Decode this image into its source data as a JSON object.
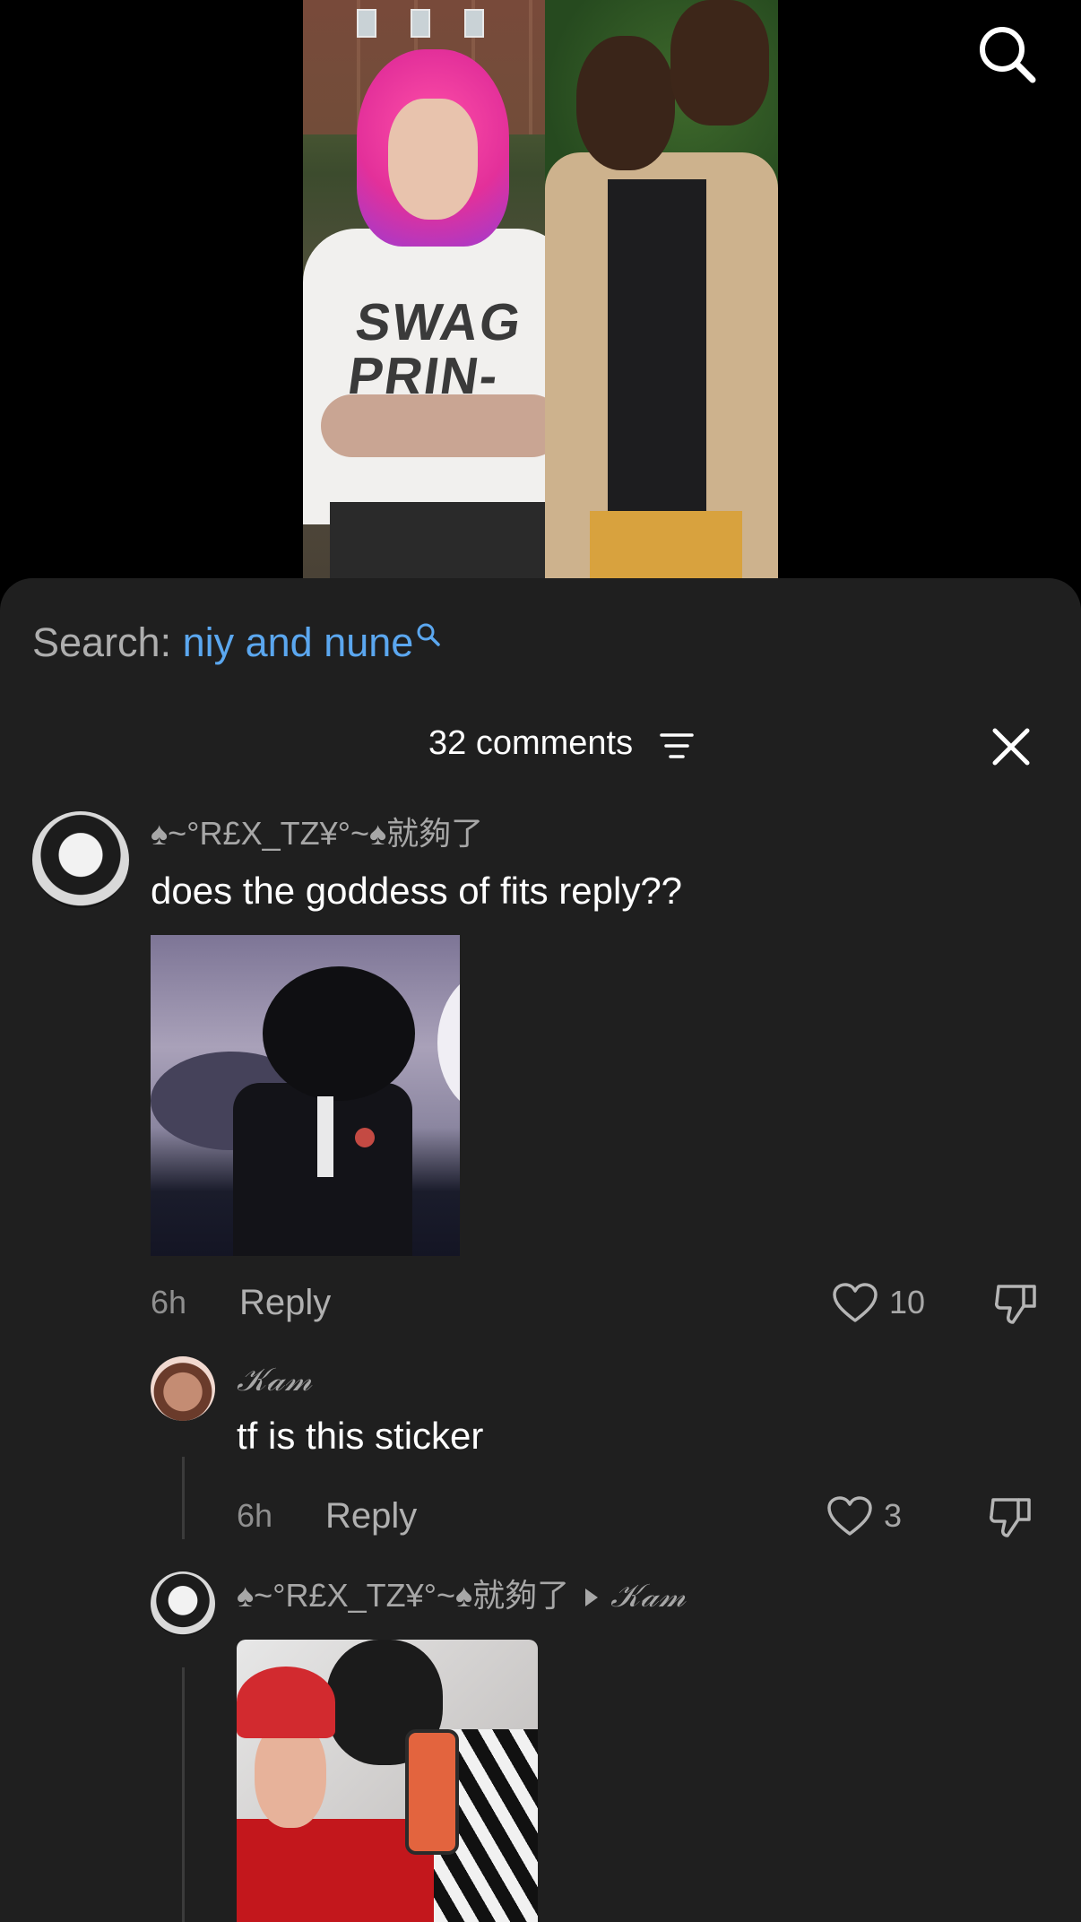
{
  "video": {
    "shirt_text_line1": "SWAG",
    "shirt_text_line2": "PRIN-"
  },
  "search": {
    "label": "Search: ",
    "query": "niy and nune"
  },
  "comments_header": {
    "count_label": "32 comments"
  },
  "comments": [
    {
      "username": "♠~°R£X_TZ¥°~♠就夠了",
      "text": "does the goddess of fits reply??",
      "time": "6h",
      "reply_label": "Reply",
      "likes": "10",
      "has_sticker": true
    }
  ],
  "replies": [
    {
      "username": "𝒦𝒶𝓂",
      "text": "tf is this sticker",
      "time": "6h",
      "reply_label": "Reply",
      "likes": "3"
    },
    {
      "username": "♠~°R£X_TZ¥°~♠就夠了",
      "reply_to": "𝒦𝒶𝓂",
      "has_photo": true
    }
  ],
  "colors": {
    "sheet_bg": "#1f1f1f",
    "search_query": "#5ba7ef",
    "muted_text": "#a7a7a7"
  },
  "icons": [
    "search-icon",
    "filter-icon",
    "close-icon",
    "heart-icon",
    "dislike-icon",
    "arrow-right-icon"
  ]
}
